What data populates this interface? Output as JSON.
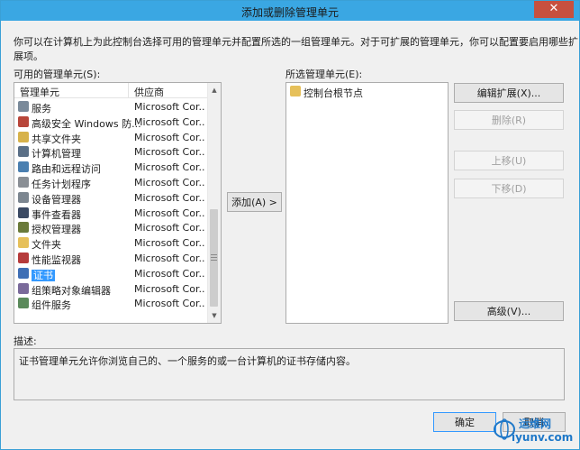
{
  "window": {
    "title": "添加或删除管理单元",
    "close_label": "✕"
  },
  "intro": "你可以在计算机上为此控制台选择可用的管理单元并配置所选的一组管理单元。对于可扩展的管理单元，你可以配置要启用哪些扩展项。",
  "available": {
    "label": "可用的管理单元(S):",
    "col_name": "管理单元",
    "col_vendor": "供应商",
    "items": [
      {
        "name": "服务",
        "vendor": "Microsoft Cor...",
        "icon": "gear-icon",
        "color": "#7a8a9a"
      },
      {
        "name": "高级安全 Windows 防...",
        "vendor": "Microsoft Cor...",
        "icon": "firewall-icon",
        "color": "#b8463a"
      },
      {
        "name": "共享文件夹",
        "vendor": "Microsoft Cor...",
        "icon": "shared-folder-icon",
        "color": "#d7b24a"
      },
      {
        "name": "计算机管理",
        "vendor": "Microsoft Cor...",
        "icon": "computer-management-icon",
        "color": "#5a6f86"
      },
      {
        "name": "路由和远程访问",
        "vendor": "Microsoft Cor...",
        "icon": "routing-icon",
        "color": "#4a7fb0"
      },
      {
        "name": "任务计划程序",
        "vendor": "Microsoft Cor...",
        "icon": "clock-icon",
        "color": "#8a8f95"
      },
      {
        "name": "设备管理器",
        "vendor": "Microsoft Cor...",
        "icon": "device-manager-icon",
        "color": "#7c8690"
      },
      {
        "name": "事件查看器",
        "vendor": "Microsoft Cor...",
        "icon": "event-viewer-icon",
        "color": "#3b4a63"
      },
      {
        "name": "授权管理器",
        "vendor": "Microsoft Cor...",
        "icon": "authorization-icon",
        "color": "#6a7a3a"
      },
      {
        "name": "文件夹",
        "vendor": "Microsoft Cor...",
        "icon": "folder-icon",
        "color": "#e6c05a"
      },
      {
        "name": "性能监视器",
        "vendor": "Microsoft Cor...",
        "icon": "performance-icon",
        "color": "#b63b3b"
      },
      {
        "name": "证书",
        "vendor": "Microsoft Cor...",
        "icon": "certificate-icon",
        "color": "#3f6fb5",
        "selected": true
      },
      {
        "name": "组策略对象编辑器",
        "vendor": "Microsoft Cor...",
        "icon": "group-policy-icon",
        "color": "#7a6a9a"
      },
      {
        "name": "组件服务",
        "vendor": "Microsoft Cor...",
        "icon": "component-services-icon",
        "color": "#5b8a5b"
      }
    ]
  },
  "add_button": "添加(A) >",
  "selected": {
    "label": "所选管理单元(E):",
    "items": [
      {
        "name": "控制台根节点",
        "icon": "folder-icon",
        "color": "#e6c05a"
      }
    ]
  },
  "buttons": {
    "edit_extensions": "编辑扩展(X)...",
    "remove": "删除(R)",
    "move_up": "上移(U)",
    "move_down": "下移(D)",
    "advanced": "高级(V)...",
    "ok": "确定",
    "cancel": "取消"
  },
  "description": {
    "label": "描述:",
    "text": "证书管理单元允许你浏览自己的、一个服务的或一台计算机的证书存储内容。"
  },
  "watermark": {
    "line1": "运维网",
    "line2": "iyunv.com",
    "color": "#1f78c8"
  }
}
